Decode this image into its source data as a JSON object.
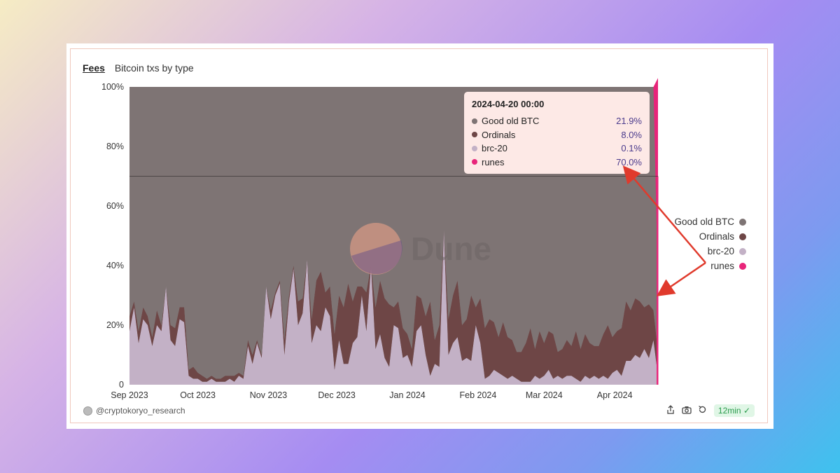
{
  "header": {
    "tab_label": "Fees",
    "title": "Bitcoin txs by type"
  },
  "watermark": "Dune",
  "author": "@cryptokoryo_research",
  "refresh_badge": "12min",
  "icons": [
    "share-icon",
    "camera-icon",
    "refresh-icon",
    "check-circle-icon"
  ],
  "colors": {
    "good_old_btc": "#7e7474",
    "ordinals": "#6e4646",
    "brc20": "#c3b1c6",
    "runes": "#e8257a",
    "arrow": "#e03a2c"
  },
  "tooltip": {
    "title": "2024-04-20 00:00",
    "rows": [
      {
        "name": "Good old BTC",
        "value": "21.9%",
        "color": "#7e7474"
      },
      {
        "name": "Ordinals",
        "value": "8.0%",
        "color": "#6e4646"
      },
      {
        "name": "brc-20",
        "value": "0.1%",
        "color": "#c3b1c6"
      },
      {
        "name": "runes",
        "value": "70.0%",
        "color": "#e8257a"
      }
    ]
  },
  "legend": [
    {
      "name": "Good old BTC",
      "color": "#7e7474"
    },
    {
      "name": "Ordinals",
      "color": "#6e4646"
    },
    {
      "name": "brc-20",
      "color": "#c3b1c6"
    },
    {
      "name": "runes",
      "color": "#e8257a"
    }
  ],
  "chart_data": {
    "type": "area",
    "stacked": "percent",
    "title": "Bitcoin txs by type",
    "ylim": [
      0,
      100
    ],
    "y_ticks": [
      "0",
      "20%",
      "40%",
      "60%",
      "80%",
      "100%"
    ],
    "x_range": [
      "2023-09-01",
      "2024-04-20"
    ],
    "x_ticks": [
      {
        "date": "2023-09-01",
        "label": "Sep 2023"
      },
      {
        "date": "2023-10-01",
        "label": "Oct 2023"
      },
      {
        "date": "2023-11-01",
        "label": "Nov 2023"
      },
      {
        "date": "2023-12-01",
        "label": "Dec 2023"
      },
      {
        "date": "2024-01-01",
        "label": "Jan 2024"
      },
      {
        "date": "2024-02-01",
        "label": "Feb 2024"
      },
      {
        "date": "2024-03-01",
        "label": "Mar 2024"
      },
      {
        "date": "2024-04-01",
        "label": "Apr 2024"
      }
    ],
    "highlight_date": "2024-04-20",
    "reference_line_y": 70,
    "legend_position": "right",
    "x": [
      "2023-09-01",
      "2023-09-03",
      "2023-09-05",
      "2023-09-07",
      "2023-09-09",
      "2023-09-11",
      "2023-09-13",
      "2023-09-15",
      "2023-09-17",
      "2023-09-19",
      "2023-09-21",
      "2023-09-23",
      "2023-09-25",
      "2023-09-27",
      "2023-09-29",
      "2023-10-01",
      "2023-10-03",
      "2023-10-05",
      "2023-10-07",
      "2023-10-09",
      "2023-10-11",
      "2023-10-13",
      "2023-10-15",
      "2023-10-17",
      "2023-10-19",
      "2023-10-21",
      "2023-10-23",
      "2023-10-25",
      "2023-10-27",
      "2023-10-29",
      "2023-10-31",
      "2023-11-02",
      "2023-11-04",
      "2023-11-06",
      "2023-11-08",
      "2023-11-10",
      "2023-11-12",
      "2023-11-14",
      "2023-11-16",
      "2023-11-18",
      "2023-11-20",
      "2023-11-22",
      "2023-11-24",
      "2023-11-26",
      "2023-11-28",
      "2023-11-30",
      "2023-12-02",
      "2023-12-04",
      "2023-12-06",
      "2023-12-08",
      "2023-12-10",
      "2023-12-12",
      "2023-12-14",
      "2023-12-16",
      "2023-12-18",
      "2023-12-20",
      "2023-12-22",
      "2023-12-24",
      "2023-12-26",
      "2023-12-28",
      "2023-12-30",
      "2024-01-01",
      "2024-01-03",
      "2024-01-05",
      "2024-01-07",
      "2024-01-09",
      "2024-01-11",
      "2024-01-13",
      "2024-01-15",
      "2024-01-17",
      "2024-01-19",
      "2024-01-21",
      "2024-01-23",
      "2024-01-25",
      "2024-01-27",
      "2024-01-29",
      "2024-01-31",
      "2024-02-02",
      "2024-02-04",
      "2024-02-06",
      "2024-02-08",
      "2024-02-10",
      "2024-02-12",
      "2024-02-14",
      "2024-02-16",
      "2024-02-18",
      "2024-02-20",
      "2024-02-22",
      "2024-02-24",
      "2024-02-26",
      "2024-02-28",
      "2024-03-01",
      "2024-03-03",
      "2024-03-05",
      "2024-03-07",
      "2024-03-09",
      "2024-03-11",
      "2024-03-13",
      "2024-03-15",
      "2024-03-17",
      "2024-03-19",
      "2024-03-21",
      "2024-03-23",
      "2024-03-25",
      "2024-03-27",
      "2024-03-29",
      "2024-03-31",
      "2024-04-02",
      "2024-04-04",
      "2024-04-06",
      "2024-04-08",
      "2024-04-10",
      "2024-04-12",
      "2024-04-14",
      "2024-04-16",
      "2024-04-18",
      "2024-04-20"
    ],
    "series": [
      {
        "name": "brc-20",
        "values": [
          18,
          26,
          14,
          22,
          20,
          13,
          20,
          18,
          33,
          15,
          13,
          22,
          21,
          3,
          2,
          2,
          1,
          1,
          2,
          1,
          1,
          1,
          2,
          1,
          3,
          2,
          13,
          7,
          14,
          9,
          33,
          22,
          30,
          34,
          10,
          28,
          39,
          20,
          24,
          42,
          14,
          20,
          18,
          26,
          23,
          5,
          15,
          7,
          7,
          14,
          16,
          30,
          18,
          40,
          12,
          17,
          9,
          6,
          20,
          19,
          9,
          10,
          6,
          18,
          20,
          10,
          3,
          7,
          6,
          52,
          10,
          14,
          16,
          8,
          9,
          8,
          20,
          14,
          2,
          3,
          5,
          4,
          3,
          2,
          3,
          2,
          1,
          1,
          1,
          3,
          2,
          3,
          5,
          2,
          3,
          2,
          3,
          3,
          2,
          1,
          3,
          2,
          3,
          2,
          3,
          2,
          4,
          5,
          3,
          8,
          8,
          10,
          9,
          12,
          9,
          15,
          3
        ]
      },
      {
        "name": "Ordinals",
        "values": [
          5,
          2,
          4,
          4,
          3,
          3,
          5,
          2,
          0,
          5,
          6,
          4,
          5,
          2,
          4,
          2,
          2,
          1,
          1,
          1,
          1,
          2,
          1,
          2,
          1,
          1,
          2,
          3,
          1,
          1,
          0,
          3,
          1,
          1,
          5,
          2,
          1,
          8,
          5,
          0,
          8,
          15,
          20,
          5,
          10,
          12,
          15,
          19,
          27,
          14,
          17,
          3,
          13,
          0,
          14,
          18,
          20,
          21,
          6,
          9,
          10,
          7,
          6,
          12,
          9,
          13,
          25,
          8,
          14,
          0,
          12,
          16,
          19,
          12,
          13,
          22,
          6,
          15,
          17,
          19,
          16,
          12,
          18,
          14,
          12,
          9,
          10,
          13,
          18,
          9,
          16,
          11,
          13,
          15,
          8,
          10,
          12,
          10,
          16,
          11,
          14,
          12,
          10,
          11,
          14,
          18,
          12,
          13,
          16,
          20,
          17,
          19,
          19,
          14,
          18,
          10,
          8
        ]
      },
      {
        "name": "Good old BTC",
        "values": [
          77,
          72,
          82,
          74,
          77,
          84,
          75,
          80,
          67,
          80,
          81,
          74,
          74,
          95,
          94,
          96,
          97,
          98,
          97,
          98,
          98,
          97,
          97,
          97,
          96,
          97,
          85,
          90,
          85,
          90,
          67,
          75,
          69,
          65,
          85,
          70,
          60,
          72,
          71,
          58,
          78,
          65,
          62,
          69,
          67,
          83,
          70,
          74,
          66,
          72,
          67,
          67,
          69,
          60,
          74,
          65,
          71,
          73,
          74,
          72,
          81,
          83,
          88,
          70,
          71,
          77,
          72,
          85,
          80,
          48,
          78,
          70,
          65,
          80,
          78,
          70,
          74,
          71,
          81,
          78,
          79,
          84,
          79,
          84,
          85,
          89,
          89,
          86,
          81,
          88,
          82,
          86,
          82,
          83,
          89,
          88,
          85,
          87,
          82,
          88,
          83,
          86,
          87,
          87,
          83,
          80,
          84,
          82,
          81,
          72,
          75,
          71,
          72,
          74,
          73,
          75,
          22
        ]
      },
      {
        "name": "runes",
        "values": [
          0,
          0,
          0,
          0,
          0,
          0,
          0,
          0,
          0,
          0,
          0,
          0,
          0,
          0,
          0,
          0,
          0,
          0,
          0,
          0,
          0,
          0,
          0,
          0,
          0,
          0,
          0,
          0,
          0,
          0,
          0,
          0,
          0,
          0,
          0,
          0,
          0,
          0,
          0,
          0,
          0,
          0,
          0,
          0,
          0,
          0,
          0,
          0,
          0,
          0,
          0,
          0,
          0,
          0,
          0,
          0,
          0,
          0,
          0,
          0,
          0,
          0,
          0,
          0,
          0,
          0,
          0,
          0,
          0,
          0,
          0,
          0,
          0,
          0,
          0,
          0,
          0,
          0,
          0,
          0,
          0,
          0,
          0,
          0,
          0,
          0,
          0,
          0,
          0,
          0,
          0,
          0,
          0,
          0,
          0,
          0,
          0,
          0,
          0,
          0,
          0,
          0,
          0,
          0,
          0,
          0,
          0,
          0,
          0,
          0,
          0,
          0,
          0,
          0,
          0,
          0,
          70
        ]
      }
    ]
  }
}
